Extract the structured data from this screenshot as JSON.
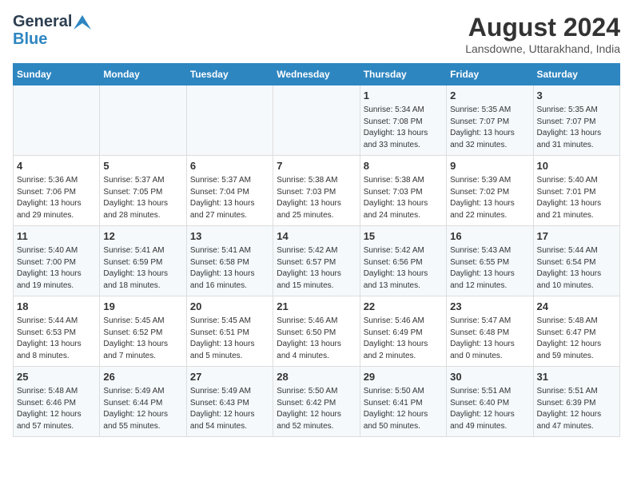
{
  "logo": {
    "line1": "General",
    "line2": "Blue"
  },
  "title": "August 2024",
  "subtitle": "Lansdowne, Uttarakhand, India",
  "days_of_week": [
    "Sunday",
    "Monday",
    "Tuesday",
    "Wednesday",
    "Thursday",
    "Friday",
    "Saturday"
  ],
  "weeks": [
    [
      {
        "day": "",
        "info": ""
      },
      {
        "day": "",
        "info": ""
      },
      {
        "day": "",
        "info": ""
      },
      {
        "day": "",
        "info": ""
      },
      {
        "day": "1",
        "info": "Sunrise: 5:34 AM\nSunset: 7:08 PM\nDaylight: 13 hours\nand 33 minutes."
      },
      {
        "day": "2",
        "info": "Sunrise: 5:35 AM\nSunset: 7:07 PM\nDaylight: 13 hours\nand 32 minutes."
      },
      {
        "day": "3",
        "info": "Sunrise: 5:35 AM\nSunset: 7:07 PM\nDaylight: 13 hours\nand 31 minutes."
      }
    ],
    [
      {
        "day": "4",
        "info": "Sunrise: 5:36 AM\nSunset: 7:06 PM\nDaylight: 13 hours\nand 29 minutes."
      },
      {
        "day": "5",
        "info": "Sunrise: 5:37 AM\nSunset: 7:05 PM\nDaylight: 13 hours\nand 28 minutes."
      },
      {
        "day": "6",
        "info": "Sunrise: 5:37 AM\nSunset: 7:04 PM\nDaylight: 13 hours\nand 27 minutes."
      },
      {
        "day": "7",
        "info": "Sunrise: 5:38 AM\nSunset: 7:03 PM\nDaylight: 13 hours\nand 25 minutes."
      },
      {
        "day": "8",
        "info": "Sunrise: 5:38 AM\nSunset: 7:03 PM\nDaylight: 13 hours\nand 24 minutes."
      },
      {
        "day": "9",
        "info": "Sunrise: 5:39 AM\nSunset: 7:02 PM\nDaylight: 13 hours\nand 22 minutes."
      },
      {
        "day": "10",
        "info": "Sunrise: 5:40 AM\nSunset: 7:01 PM\nDaylight: 13 hours\nand 21 minutes."
      }
    ],
    [
      {
        "day": "11",
        "info": "Sunrise: 5:40 AM\nSunset: 7:00 PM\nDaylight: 13 hours\nand 19 minutes."
      },
      {
        "day": "12",
        "info": "Sunrise: 5:41 AM\nSunset: 6:59 PM\nDaylight: 13 hours\nand 18 minutes."
      },
      {
        "day": "13",
        "info": "Sunrise: 5:41 AM\nSunset: 6:58 PM\nDaylight: 13 hours\nand 16 minutes."
      },
      {
        "day": "14",
        "info": "Sunrise: 5:42 AM\nSunset: 6:57 PM\nDaylight: 13 hours\nand 15 minutes."
      },
      {
        "day": "15",
        "info": "Sunrise: 5:42 AM\nSunset: 6:56 PM\nDaylight: 13 hours\nand 13 minutes."
      },
      {
        "day": "16",
        "info": "Sunrise: 5:43 AM\nSunset: 6:55 PM\nDaylight: 13 hours\nand 12 minutes."
      },
      {
        "day": "17",
        "info": "Sunrise: 5:44 AM\nSunset: 6:54 PM\nDaylight: 13 hours\nand 10 minutes."
      }
    ],
    [
      {
        "day": "18",
        "info": "Sunrise: 5:44 AM\nSunset: 6:53 PM\nDaylight: 13 hours\nand 8 minutes."
      },
      {
        "day": "19",
        "info": "Sunrise: 5:45 AM\nSunset: 6:52 PM\nDaylight: 13 hours\nand 7 minutes."
      },
      {
        "day": "20",
        "info": "Sunrise: 5:45 AM\nSunset: 6:51 PM\nDaylight: 13 hours\nand 5 minutes."
      },
      {
        "day": "21",
        "info": "Sunrise: 5:46 AM\nSunset: 6:50 PM\nDaylight: 13 hours\nand 4 minutes."
      },
      {
        "day": "22",
        "info": "Sunrise: 5:46 AM\nSunset: 6:49 PM\nDaylight: 13 hours\nand 2 minutes."
      },
      {
        "day": "23",
        "info": "Sunrise: 5:47 AM\nSunset: 6:48 PM\nDaylight: 13 hours\nand 0 minutes."
      },
      {
        "day": "24",
        "info": "Sunrise: 5:48 AM\nSunset: 6:47 PM\nDaylight: 12 hours\nand 59 minutes."
      }
    ],
    [
      {
        "day": "25",
        "info": "Sunrise: 5:48 AM\nSunset: 6:46 PM\nDaylight: 12 hours\nand 57 minutes."
      },
      {
        "day": "26",
        "info": "Sunrise: 5:49 AM\nSunset: 6:44 PM\nDaylight: 12 hours\nand 55 minutes."
      },
      {
        "day": "27",
        "info": "Sunrise: 5:49 AM\nSunset: 6:43 PM\nDaylight: 12 hours\nand 54 minutes."
      },
      {
        "day": "28",
        "info": "Sunrise: 5:50 AM\nSunset: 6:42 PM\nDaylight: 12 hours\nand 52 minutes."
      },
      {
        "day": "29",
        "info": "Sunrise: 5:50 AM\nSunset: 6:41 PM\nDaylight: 12 hours\nand 50 minutes."
      },
      {
        "day": "30",
        "info": "Sunrise: 5:51 AM\nSunset: 6:40 PM\nDaylight: 12 hours\nand 49 minutes."
      },
      {
        "day": "31",
        "info": "Sunrise: 5:51 AM\nSunset: 6:39 PM\nDaylight: 12 hours\nand 47 minutes."
      }
    ]
  ]
}
